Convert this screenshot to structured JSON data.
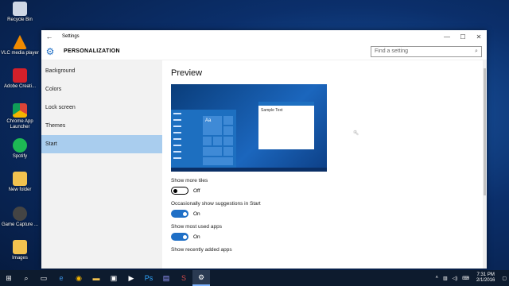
{
  "desktop": {
    "icons": [
      {
        "label": "Recycle Bin",
        "icon": "recycle-bin-icon",
        "color": "#cfd8e6"
      },
      {
        "label": "VLC media player",
        "icon": "vlc-icon",
        "color": "#f08a00"
      },
      {
        "label": "Adobe Creati...",
        "icon": "adobe-icon",
        "color": "#d4202a"
      },
      {
        "label": "Chrome App Launcher",
        "icon": "chrome-app-launcher-icon",
        "color": "#e8e8e8"
      },
      {
        "label": "Spotify",
        "icon": "spotify-icon",
        "color": "#1db954"
      },
      {
        "label": "New folder",
        "icon": "folder-icon",
        "color": "#f2c24f"
      },
      {
        "label": "Game Capture ...",
        "icon": "game-capture-icon",
        "color": "#444444"
      },
      {
        "label": "Images",
        "icon": "folder-icon",
        "color": "#f2c24f"
      }
    ]
  },
  "window": {
    "title": "Settings",
    "back_icon": "back-arrow-icon",
    "minimize": "—",
    "maximize": "☐",
    "close": "✕"
  },
  "header": {
    "section_title": "PERSONALIZATION",
    "search_placeholder": "Find a setting",
    "accent": "#1f6fc6"
  },
  "sidebar": {
    "items": [
      {
        "label": "Background"
      },
      {
        "label": "Colors"
      },
      {
        "label": "Lock screen"
      },
      {
        "label": "Themes"
      },
      {
        "label": "Start"
      }
    ],
    "selected": "Start"
  },
  "content": {
    "heading": "Preview",
    "preview_sample_text": "Sample Text",
    "preview_tile_text": "Aa",
    "settings": [
      {
        "label": "Show more tiles",
        "state": "Off"
      },
      {
        "label": "Occasionally show suggestions in Start",
        "state": "On"
      },
      {
        "label": "Show most used apps",
        "state": "On"
      },
      {
        "label": "Show recently added apps"
      }
    ]
  },
  "taskbar": {
    "time": "7:31 PM",
    "date": "2/1/2016"
  }
}
